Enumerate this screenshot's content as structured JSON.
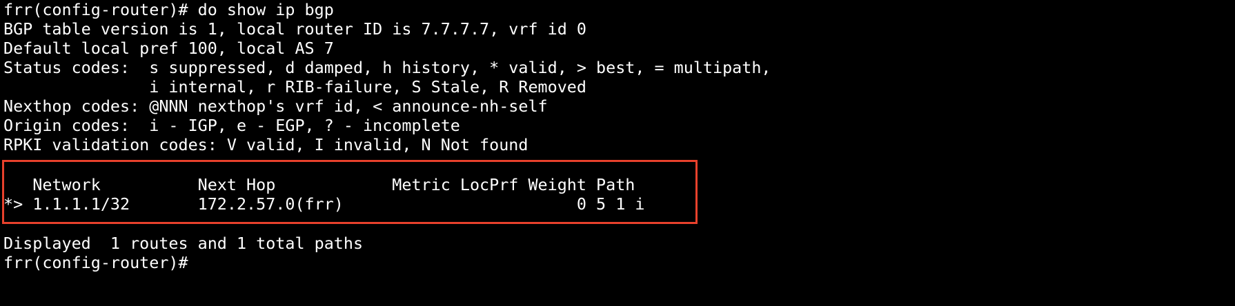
{
  "terminal": {
    "lines": {
      "l0": "frr(config-router)# do show ip bgp",
      "l1": "BGP table version is 1, local router ID is 7.7.7.7, vrf id 0",
      "l2": "Default local pref 100, local AS 7",
      "l3": "Status codes:  s suppressed, d damped, h history, * valid, > best, = multipath,",
      "l4": "               i internal, r RIB-failure, S Stale, R Removed",
      "l5": "Nexthop codes: @NNN nexthop's vrf id, < announce-nh-self",
      "l6": "Origin codes:  i - IGP, e - EGP, ? - incomplete",
      "l7": "RPKI validation codes: V valid, I invalid, N Not found",
      "header": "   Network          Next Hop            Metric LocPrf Weight Path",
      "route": "*> 1.1.1.1/32       172.2.57.0(frr)                        0 5 1 i",
      "summary": "Displayed  1 routes and 1 total paths",
      "prompt": "frr(config-router)#"
    }
  },
  "colors": {
    "background": "#000000",
    "text": "#ffffff",
    "highlight_border": "#e8412c"
  }
}
